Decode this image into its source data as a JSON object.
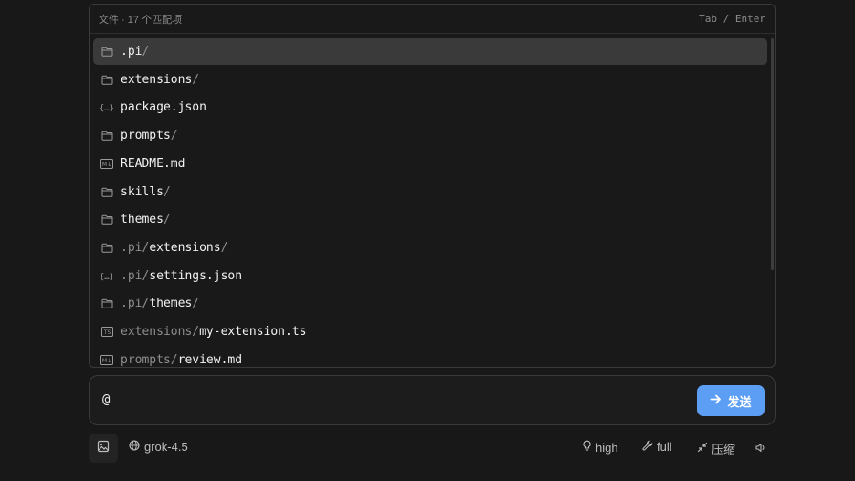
{
  "popup": {
    "header_label": "文件 · 17 个匹配项",
    "header_hint": "Tab / Enter",
    "items": [
      {
        "type": "folder",
        "dir": "",
        "name": ".pi",
        "slash": "/",
        "selected": true
      },
      {
        "type": "folder",
        "dir": "",
        "name": "extensions",
        "slash": "/"
      },
      {
        "type": "json",
        "dir": "",
        "name": "package.json",
        "slash": ""
      },
      {
        "type": "folder",
        "dir": "",
        "name": "prompts",
        "slash": "/"
      },
      {
        "type": "markdown",
        "dir": "",
        "name": "README.md",
        "slash": ""
      },
      {
        "type": "folder",
        "dir": "",
        "name": "skills",
        "slash": "/"
      },
      {
        "type": "folder",
        "dir": "",
        "name": "themes",
        "slash": "/"
      },
      {
        "type": "folder",
        "dir": ".pi/",
        "name": "extensions",
        "slash": "/"
      },
      {
        "type": "json",
        "dir": ".pi/",
        "name": "settings.json",
        "slash": ""
      },
      {
        "type": "folder",
        "dir": ".pi/",
        "name": "themes",
        "slash": "/"
      },
      {
        "type": "typescript",
        "dir": "extensions/",
        "name": "my-extension.ts",
        "slash": ""
      },
      {
        "type": "markdown",
        "dir": "prompts/",
        "name": "review.md",
        "slash": ""
      }
    ]
  },
  "composer": {
    "value": "@",
    "send_label": "发送"
  },
  "toolbar": {
    "model": "grok-4.5",
    "thinking": "high",
    "access": "full",
    "compact": "压缩"
  },
  "colors": {
    "accent": "#5b9ef4",
    "background": "#181818",
    "selected_row": "#3a3a3a"
  },
  "icons": {
    "folder": "folder-icon",
    "json": "json-file-icon",
    "markdown": "markdown-file-icon",
    "typescript": "typescript-file-icon"
  }
}
